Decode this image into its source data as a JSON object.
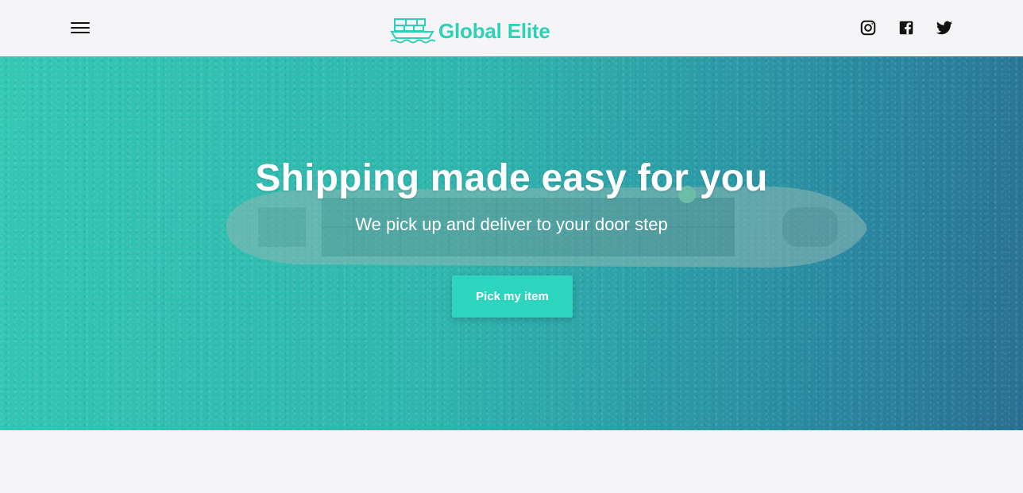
{
  "header": {
    "menu_icon": "hamburger-menu-icon",
    "brand": {
      "logo_icon": "cargo-ship-icon",
      "name": "Global Elite",
      "color": "#2ed0b6"
    },
    "socials": [
      {
        "name": "instagram",
        "icon": "instagram-icon"
      },
      {
        "name": "facebook",
        "icon": "facebook-icon"
      },
      {
        "name": "twitter",
        "icon": "twitter-icon"
      }
    ]
  },
  "hero": {
    "title": "Shipping made easy for you",
    "subtitle": "We pick up and deliver to your door step",
    "cta_label": "Pick my item",
    "background_image": "aerial-cargo-ship-on-ocean",
    "gradient_colors": [
      "#34c8b4",
      "#2a6f92"
    ],
    "cta_color": "#2dd4be"
  }
}
